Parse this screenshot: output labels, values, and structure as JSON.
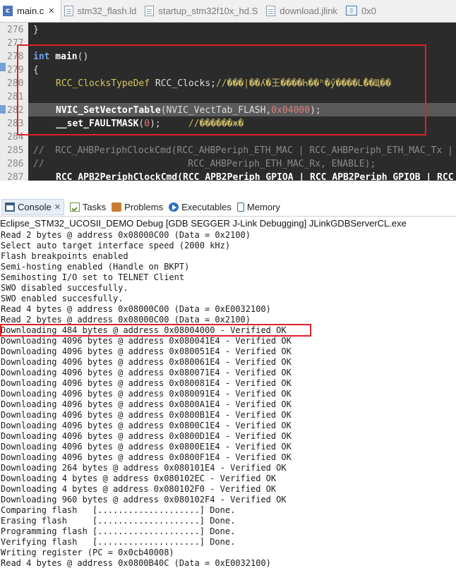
{
  "editor_tabs": [
    {
      "label": "main.c",
      "icon": "c-file-icon",
      "active": true
    },
    {
      "label": "stm32_flash.ld",
      "icon": "file-icon",
      "active": false
    },
    {
      "label": "startup_stm32f10x_hd.S",
      "icon": "file-icon",
      "active": false
    },
    {
      "label": "download.jlink",
      "icon": "file-icon",
      "active": false
    },
    {
      "label": "0x0",
      "icon": "memory-icon",
      "active": false
    }
  ],
  "editor": {
    "line_numbers": [
      "276",
      "277",
      "278",
      "279",
      "280",
      "281",
      "282",
      "283",
      "284",
      "285",
      "286",
      "287"
    ],
    "lines": {
      "l276": "}",
      "l278_kw": "int",
      "l278_fn": " main",
      "l278_rest": "()",
      "l279": "{",
      "l280_type": "RCC_ClocksTypeDef",
      "l280_var": " RCC_Clocks;",
      "l280_cmt": "//���|��ʎ�王����Һ��ʰ�ӳ����Լ̊��Щ��",
      "l282_fn": "NVIC_SetVectorTable",
      "l282_args": "(NVIC_VectTab_FLASH,",
      "l282_num": "0x04000",
      "l282_end": ");",
      "l283_fn": "__set_FAULTMASK",
      "l283_open": "(",
      "l283_num": "0",
      "l283_end": ");",
      "l283_cmt": "//������ж�",
      "l285": "//  RCC_AHBPeriphClockCmd(RCC_AHBPeriph_ETH_MAC | RCC_AHBPeriph_ETH_MAC_Tx |",
      "l286": "//                          RCC_AHBPeriph_ETH_MAC_Rx, ENABLE);",
      "l287": "RCC_APB2PeriphClockCmd(RCC_APB2Periph_GPIOA | RCC_APB2Periph_GPIOB | RCC"
    }
  },
  "console_tabs": [
    {
      "label": "Console",
      "icon": "console-icon",
      "active": true,
      "close": "✕"
    },
    {
      "label": "Tasks",
      "icon": "tasks-icon",
      "active": false
    },
    {
      "label": "Problems",
      "icon": "problems-icon",
      "active": false
    },
    {
      "label": "Executables",
      "icon": "executables-icon",
      "active": false
    },
    {
      "label": "Memory",
      "icon": "memory-icon",
      "active": false
    }
  ],
  "console_title": "Eclipse_STM32_UCOSII_DEMO Debug [GDB SEGGER J-Link Debugging] JLinkGDBServerCL.exe",
  "console_lines": [
    "Read 2 bytes @ address 0x08000C00 (Data = 0x2100)",
    "Select auto target interface speed (2000 kHz)",
    "Flash breakpoints enabled",
    "Semi-hosting enabled (Handle on BKPT)",
    "Semihosting I/O set to TELNET Client",
    "SWO disabled succesfully.",
    "SWO enabled succesfully.",
    "Read 4 bytes @ address 0x08000C00 (Data = 0xE0032100)",
    "Read 2 bytes @ address 0x08000C00 (Data = 0x2100)",
    "Downloading 484 bytes @ address 0x08004000 - Verified OK",
    "Downloading 4096 bytes @ address 0x080041E4 - Verified OK",
    "Downloading 4096 bytes @ address 0x080051E4 - Verified OK",
    "Downloading 4096 bytes @ address 0x080061E4 - Verified OK",
    "Downloading 4096 bytes @ address 0x080071E4 - Verified OK",
    "Downloading 4096 bytes @ address 0x080081E4 - Verified OK",
    "Downloading 4096 bytes @ address 0x080091E4 - Verified OK",
    "Downloading 4096 bytes @ address 0x0800A1E4 - Verified OK",
    "Downloading 4096 bytes @ address 0x0800B1E4 - Verified OK",
    "Downloading 4096 bytes @ address 0x0800C1E4 - Verified OK",
    "Downloading 4096 bytes @ address 0x0800D1E4 - Verified OK",
    "Downloading 4096 bytes @ address 0x0800E1E4 - Verified OK",
    "Downloading 4096 bytes @ address 0x0800F1E4 - Verified OK",
    "Downloading 264 bytes @ address 0x080101E4 - Verified OK",
    "Downloading 4 bytes @ address 0x080102EC - Verified OK",
    "Downloading 4 bytes @ address 0x080102F0 - Verified OK",
    "Downloading 960 bytes @ address 0x080102F4 - Verified OK",
    "Comparing flash   [....................] Done.",
    "Erasing flash     [....................] Done.",
    "Programming flash [....................] Done.",
    "Verifying flash   [....................] Done.",
    "Writing register (PC = 0x0cb40008)",
    "Read 4 bytes @ address 0x0800B40C (Data = 0xE0032100)"
  ],
  "colors": {
    "annotation_red": "#e0202a",
    "editor_bg": "#2b2b2b",
    "keyword_blue": "#6ea4e6",
    "number_red": "#e27a7a",
    "type_yellow": "#d4c45e"
  }
}
